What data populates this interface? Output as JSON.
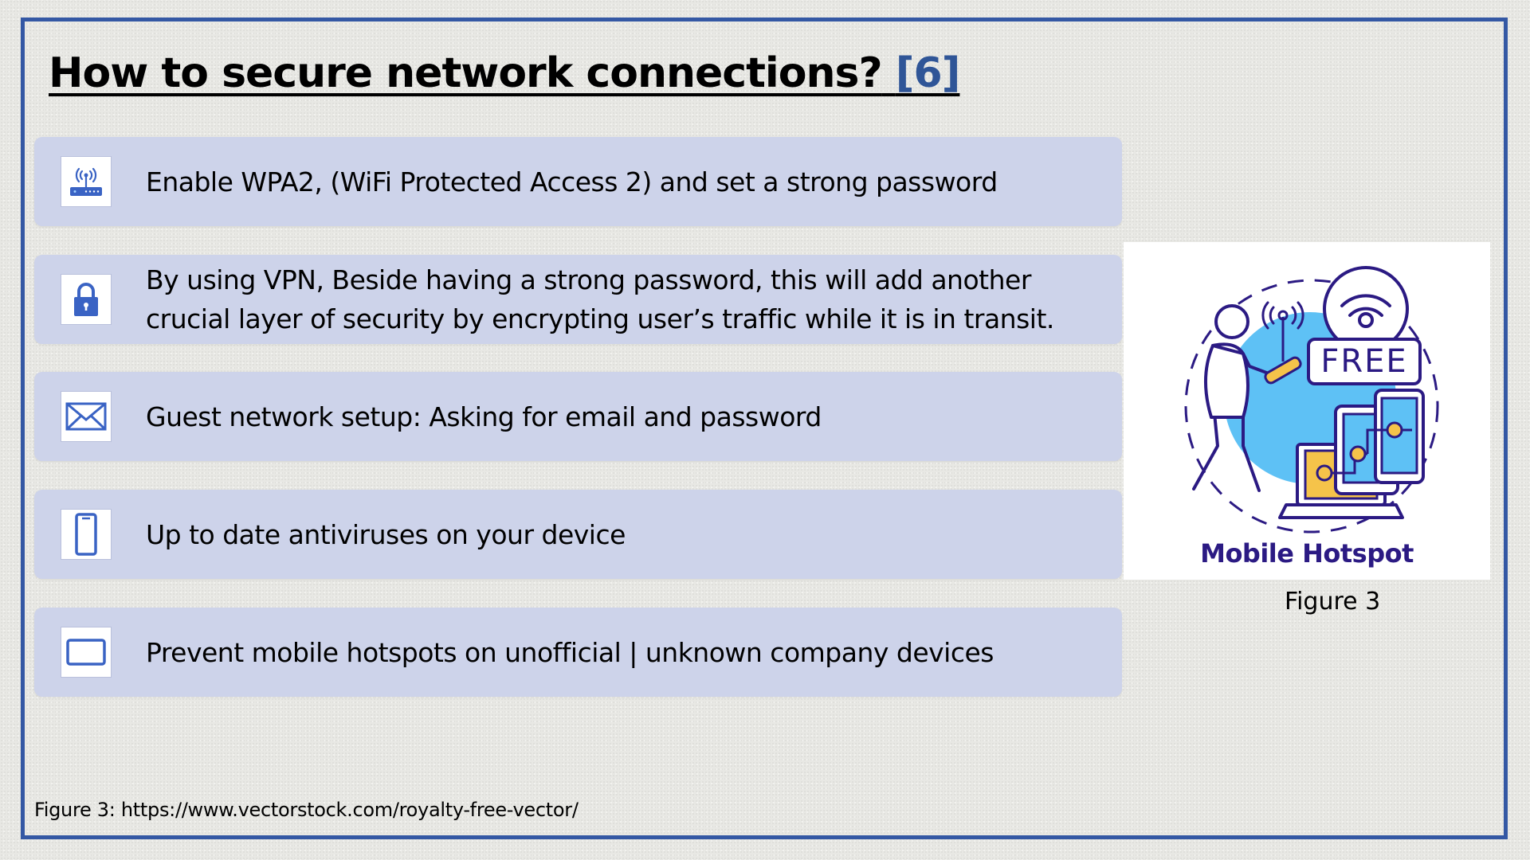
{
  "slide": {
    "title": "How to secure network connections?",
    "title_ref": "[6]",
    "items": [
      {
        "icon": "wifi-router-icon",
        "text": "Enable WPA2, (WiFi Protected Access 2) and set a strong password"
      },
      {
        "icon": "lock-icon",
        "text": "By using VPN, Beside having a strong password, this will add another crucial layer of security by encrypting user’s traffic while it is in transit."
      },
      {
        "icon": "envelope-icon",
        "text": "Guest network setup: Asking for email and password"
      },
      {
        "icon": "phone-icon",
        "text": "Up to date antiviruses on your device"
      },
      {
        "icon": "laptop-icon",
        "text": "Prevent mobile hotspots on unofficial | unknown company devices"
      }
    ],
    "figure": {
      "badge_text": "FREE",
      "label": "Mobile Hotspot",
      "caption": "Figure 3"
    },
    "source_note": "Figure 3: https://www.vectorstock.com/royalty-free-vector/",
    "colors": {
      "frame": "#3458a4",
      "item_background": "#cdd3ea",
      "icon_blue": "#3a63c4",
      "reference_link": "#2f5597",
      "figure_label": "#2b1a83",
      "figure_accent_blue": "#5ec1f5",
      "figure_accent_yellow": "#f5c34a"
    }
  }
}
